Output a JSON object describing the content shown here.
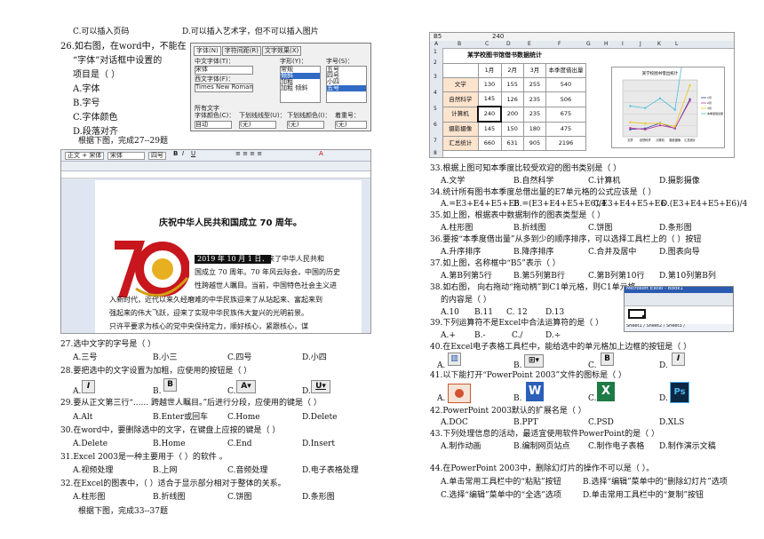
{
  "left": {
    "q25": {
      "c": "C.可以插入页码",
      "d": "D.可以插入艺术字，但不可以插入图片"
    },
    "q26": {
      "stem1": "26.如右图，在word中，不能在",
      "stem2": "“字体”对话框中设置的",
      "stem3": "项目是（      ）",
      "a": "A.字体",
      "b": "B.字号",
      "c": "C.字体颜色",
      "d": "D.段落对齐"
    },
    "font_dialog": {
      "tabs": [
        "字体(N)",
        "字符间距(R)",
        "文字效果(X)"
      ],
      "cn_font_label": "中文字体(T)：",
      "cn_font_value": "宋体",
      "western_label": "西文字体(F)：",
      "western_value": "Times New Roman",
      "style_label": "字形(Y)：",
      "style_items": [
        "常规",
        "倾斜",
        "加粗",
        "加粗 倾斜"
      ],
      "size_label": "字号(S)：",
      "size_items": [
        "五号",
        "四号",
        "小四",
        "五号",
        "小五"
      ],
      "all_text_label": "所有文字",
      "color_label": "字体颜色(C)：",
      "color_value": "自动",
      "underline_label": "下划线线型(U)：",
      "underline_value": "(无)",
      "ucolor_label": "下划线颜色(I)：",
      "ucolor_value": "(无)",
      "emph_label": "着重号：",
      "emph_value": "(无)"
    },
    "intro_27": "根据下图，完成27--29题",
    "word_doc": {
      "toolbar_style": "正文 + 宋体",
      "toolbar_font": "宋体",
      "toolbar_size": "四号",
      "title": "庆祝中华人民共和国成立 70 周年。",
      "line1_sel": "2019 年 10 月 1 日，",
      "line1_rest": "迎来了中华人民共和",
      "line2": "国成立 70 周年。70 年风云际会，中国的历史",
      "line3": "性跨越世人瞩目。当前，中国特色社会主义进",
      "line4": "入新时代，近代以来久经磨难的中华民族迎来了从站起来、富起来到",
      "line5": "强起来的伟大飞跃，迎来了实现中华民族伟大复兴的光明前景。",
      "line6": "只许平要求为核心的党中央保持定力，顺好核心，紧跟核心，谋",
      "logo_text": "70"
    },
    "q27": {
      "stem": "27.选中文字的字号是（      ）",
      "a": "A.三号",
      "b": "B.小三",
      "c": "C.四号",
      "d": "D.小四"
    },
    "q28": {
      "stem": "28.要把选中的文字设置为加粗，应使用的按钮是（      ）",
      "a": "A.",
      "b": "B.",
      "c": "C.",
      "d": "D."
    },
    "q29": {
      "stem": "29.要从正文第三行“...... 跨越世人瞩目。”后进行分段，应使用的键是（      ）",
      "a": "A.Alt",
      "b": "B.Enter或回车",
      "c": "C.Home",
      "d": "D.Delete"
    },
    "q30": {
      "stem": "30.在word中，要删除选中的文字，在键盘上应按的键是（      ）",
      "a": "A.Delete",
      "b": "B.Home",
      "c": "C.End",
      "d": "D.Insert"
    },
    "q31": {
      "stem": "31.Excel    2003是一种主要用于（      ）的软件    。",
      "a": "A.视频处理",
      "b": "B.上网",
      "c": "C.音频处理",
      "d": "D.电子表格处理"
    },
    "q32": {
      "stem": "32.在Excel的图表中，（      ）适合于显示部分相对于整体的关系。",
      "a": "A.柱形图",
      "b": "B.折线图",
      "c": "C.饼图",
      "d": "D.条形图"
    },
    "intro_33": "根据下图，完成33--37题"
  },
  "right": {
    "sheet": {
      "cell_ref": "B5",
      "formula_value": "240",
      "col_headers": [
        "A",
        "B",
        "C",
        "D",
        "E",
        "F",
        "G",
        "H",
        "I",
        "J",
        "K",
        "L"
      ],
      "row_numbers": [
        "1",
        "2",
        "3",
        "4",
        "5",
        "6",
        "7",
        "8"
      ],
      "title": "某学校图书馆借书数据统计",
      "header": [
        "",
        "1月",
        "2月",
        "3月",
        "本季度借出量"
      ],
      "rows": [
        [
          "文学",
          "130",
          "155",
          "255",
          "540"
        ],
        [
          "自然科学",
          "145",
          "126",
          "235",
          "506"
        ],
        [
          "计算机",
          "240",
          "200",
          "235",
          "675"
        ],
        [
          "摄影摄像",
          "145",
          "150",
          "180",
          "475"
        ],
        [
          "汇总统计",
          "660",
          "631",
          "905",
          "2196"
        ]
      ]
    },
    "chart_data": {
      "type": "line",
      "title": "某学校图书借出统计",
      "categories": [
        "文学",
        "自然科学",
        "计算机",
        "摄影摄像",
        "汇总统计"
      ],
      "series": [
        {
          "name": "1月",
          "values": [
            130,
            145,
            240,
            145,
            660
          ]
        },
        {
          "name": "2月",
          "values": [
            155,
            126,
            200,
            150,
            631
          ]
        },
        {
          "name": "3月",
          "values": [
            255,
            235,
            235,
            180,
            905
          ]
        },
        {
          "name": "本季度借出量",
          "values": [
            540,
            506,
            675,
            475,
            2196
          ]
        }
      ],
      "ylim": [
        0,
        1000
      ],
      "legend": "right",
      "colors": [
        "#2b3fa0",
        "#c0399c",
        "#e8c51f",
        "#4dbfd4"
      ]
    },
    "q33": {
      "stem": "33.根据上图可知本季度比较受欢迎的图书类别是（      ）",
      "a": "A.文学",
      "b": "B.自然科学",
      "c": "C.计算机",
      "d": "D.摄影摄像"
    },
    "q34": {
      "stem": "34.统计所有图书本季度总借出量的E7单元格的公式应该是（      ）",
      "a": "A.=E3+E4+E5+E6",
      "b": "B.=(E3+E4+E5+E6)/4",
      "c": "C.E3+E4+E5+E6",
      "d": "D.(E3+E4+E5+E6)/4"
    },
    "q35": {
      "stem": "35.如上图，根据表中数据制作的图表类型是（      ）",
      "a": "A.柱形图",
      "b": "B.折线图",
      "c": "C.饼图",
      "d": "D.条形图"
    },
    "q36": {
      "stem": "36.要按“本季度借出量”从多到少的顺序排序，可以选择工具栏上的（      ）按钮",
      "a": "A.升序排序",
      "b": "B.降序排序",
      "c": "C.合并及居中",
      "d": "D.图表向导"
    },
    "q37": {
      "stem": "37.如上图，名称框中“B5”表示（      ）",
      "a": "A.第B列第5行",
      "b": "B.第5列第B行",
      "c": "C.第B列第10行",
      "d": "D.第10列第B列"
    },
    "q38": {
      "stem1": "38.如右图，   向右拖动“拖动柄”到C1单元格，则C1单元格",
      "stem2": "的内容是（      ）",
      "a": "A.10",
      "b": "B.11",
      "c": "C. 12",
      "d": "D.13"
    },
    "mini_excel": {
      "title": "Microsoft Excel - Book1",
      "sheets": "Sheet1 / Sheet2 / Sheet3 /"
    },
    "q39": {
      "stem": "39.下列运算符不是Excel中合法运算符的是（      ）",
      "a": "A.+",
      "b": "B.-",
      "c": "C./",
      "d": "D.÷"
    },
    "q40": {
      "stem": "40.在Excel电子表格工具栏中，能给选中的单元格加上边框的按钮是（      ）",
      "a": "A.",
      "b": "B.",
      "c": "C.",
      "d": "D."
    },
    "q41": {
      "stem": "41.以下能打开“PowerPoint 2003”文件的图标是（      ）",
      "a": "A.",
      "b": "B.",
      "c": "C.",
      "d": "D."
    },
    "q42": {
      "stem": "42.PowerPoint 2003默认的扩展名是（      ）",
      "a": "A.DOC",
      "b": "B.PPT",
      "c": "C.PSD",
      "d": "D.XLS"
    },
    "q43": {
      "stem": "43.下列处理信息的活动，最适宜使用软件PowerPoint的是（      ）",
      "a": "A.制作动画",
      "b": "B.编制网页站点",
      "c": "C.制作电子表格",
      "d": "D.制作演示文稿"
    },
    "q44": {
      "stem": "44.在PowerPoint 2003中，删除幻灯片的操作不可以是（      ）。",
      "a": "A.单击常用工具栏中的“粘贴”按钮",
      "b": "B.选择“编辑”菜单中的“删除幻灯片”选项",
      "c": "C.选择“编辑”菜单中的“全选”选项",
      "d": "D.单击常用工具栏中的“复制”按钮"
    }
  }
}
